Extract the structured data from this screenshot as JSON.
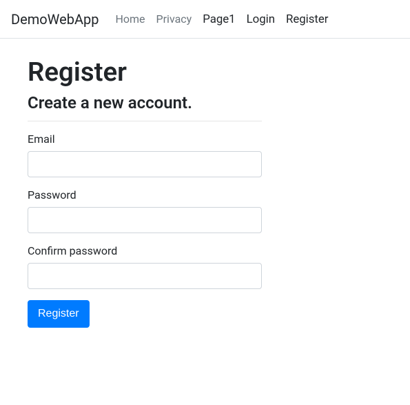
{
  "navbar": {
    "brand": "DemoWebApp",
    "links": {
      "home": "Home",
      "privacy": "Privacy",
      "page1": "Page1",
      "login": "Login",
      "register": "Register"
    }
  },
  "page": {
    "title": "Register",
    "subtitle": "Create a new account."
  },
  "form": {
    "email_label": "Email",
    "password_label": "Password",
    "confirm_password_label": "Confirm password",
    "submit_label": "Register"
  }
}
